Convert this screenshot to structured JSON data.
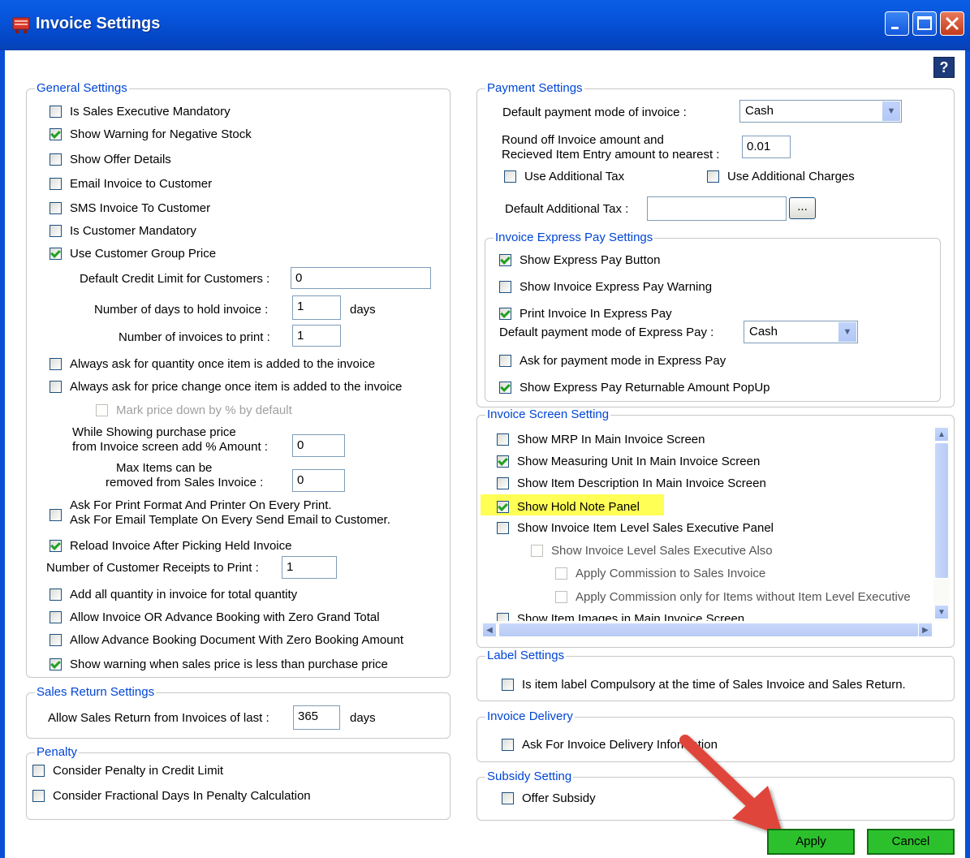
{
  "window": {
    "title": "Invoice Settings",
    "help": "?"
  },
  "general": {
    "title": "General Settings",
    "items": [
      {
        "label": "Is Sales Executive Mandatory",
        "checked": false
      },
      {
        "label": "Show Warning for Negative Stock",
        "checked": true
      },
      {
        "label": "Show Offer Details",
        "checked": false
      },
      {
        "label": "Email Invoice to Customer",
        "checked": false
      },
      {
        "label": "SMS Invoice To Customer",
        "checked": false
      },
      {
        "label": "Is Customer Mandatory",
        "checked": false
      },
      {
        "label": "Use Customer Group Price",
        "checked": true
      }
    ],
    "credit_limit_label": "Default Credit Limit  for Customers :",
    "credit_limit_value": "0",
    "hold_days_label": "Number of days to hold invoice :",
    "hold_days_value": "1",
    "hold_days_unit": "days",
    "invoices_print_label": "Number of invoices to print :",
    "invoices_print_value": "1",
    "ask_qty": "Always ask for quantity once item is added to the invoice",
    "ask_price": "Always ask for price change once item is added to the invoice",
    "mark_down": "Mark price down by % by default",
    "purchase_pct_line1": "While Showing purchase price",
    "purchase_pct_line2": "from Invoice screen add % Amount :",
    "purchase_pct_value": "0",
    "max_items_line1": "Max Items can be",
    "max_items_line2": "removed from Sales Invoice :",
    "max_items_value": "0",
    "print_format_line1": "Ask For Print Format And  Printer On Every Print.",
    "print_format_line2": "Ask For Email Template On Every Send Email to Customer.",
    "reload_held": "Reload Invoice After Picking Held Invoice",
    "receipts_label": "Number of Customer Receipts to Print :",
    "receipts_value": "1",
    "add_qty": "Add all quantity in invoice for total quantity",
    "allow_zero_grand": "Allow Invoice OR Advance Booking with Zero Grand Total",
    "allow_zero_booking": "Allow Advance Booking Document With Zero Booking Amount",
    "warn_price": "Show warning when sales price is less than purchase price"
  },
  "sales_return": {
    "title": "Sales Return Settings",
    "label": "Allow Sales Return from Invoices of last :",
    "value": "365",
    "unit": "days"
  },
  "penalty": {
    "title": "Penalty",
    "credit_limit": "Consider Penalty in Credit Limit",
    "fractional": "Consider Fractional Days In Penalty Calculation"
  },
  "payment": {
    "title": "Payment Settings",
    "mode_label": "Default payment mode of invoice :",
    "mode_value": "Cash",
    "round_line1": "Round off Invoice amount and",
    "round_line2": "Recieved Item Entry amount to nearest :",
    "round_value": "0.01",
    "additional_tax": "Use Additional Tax",
    "additional_charges": "Use Additional Charges",
    "default_tax_label": "Default Additional Tax :",
    "default_tax_value": "",
    "browse": "..."
  },
  "express": {
    "title": "Invoice Express Pay Settings",
    "show_button": "Show Express Pay Button",
    "show_warning": "Show Invoice Express Pay Warning",
    "print_invoice": "Print Invoice In Express Pay",
    "mode_label": "Default payment mode of Express Pay :",
    "mode_value": "Cash",
    "ask_mode": "Ask for payment mode in Express Pay",
    "returnable": "Show Express Pay Returnable Amount PopUp"
  },
  "screen": {
    "title": "Invoice Screen Setting",
    "mrp": "Show MRP In Main Invoice Screen",
    "measuring_unit": "Show Measuring Unit In Main Invoice Screen",
    "item_description": "Show Item Description In Main Invoice Screen",
    "hold_note": "Show Hold Note Panel",
    "item_level_exec": "Show Invoice Item Level Sales Executive Panel",
    "invoice_level_exec": "Show Invoice Level Sales Executive Also",
    "commission": "Apply Commission to Sales Invoice",
    "commission_items": "Apply Commission only for Items without Item Level Executive",
    "item_images": "Show Item Images in Main Invoice Screen"
  },
  "label_settings": {
    "title": "Label Settings",
    "compulsory": "Is item label Compulsory at the time of Sales Invoice and Sales Return."
  },
  "delivery": {
    "title": "Invoice Delivery",
    "ask": "Ask For Invoice Delivery Information"
  },
  "subsidy": {
    "title": "Subsidy Setting",
    "offer": "Offer Subsidy"
  },
  "actions": {
    "apply": "Apply",
    "cancel": "Cancel"
  },
  "colors": {
    "titlebar": "#0653d9",
    "group_title": "#0046d5",
    "button_green": "#2cc12c",
    "highlight": "#ffff55",
    "arrow": "#e0453a"
  }
}
